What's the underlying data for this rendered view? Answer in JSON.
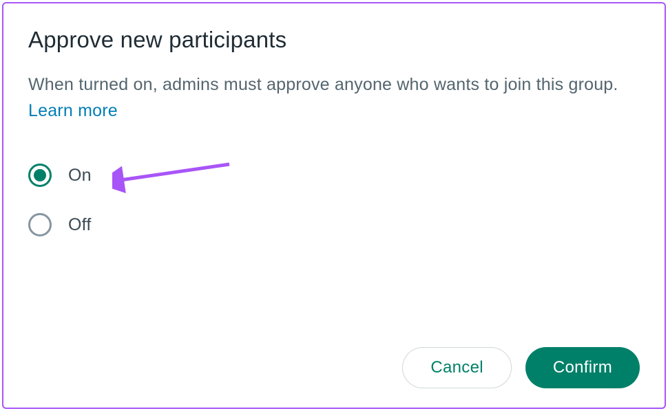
{
  "dialog": {
    "title": "Approve new participants",
    "description": "When turned on, admins must approve anyone who wants to join this group. ",
    "learn_more": "Learn more",
    "options": {
      "on": {
        "label": "On",
        "selected": true
      },
      "off": {
        "label": "Off",
        "selected": false
      }
    },
    "buttons": {
      "cancel": "Cancel",
      "confirm": "Confirm"
    }
  }
}
